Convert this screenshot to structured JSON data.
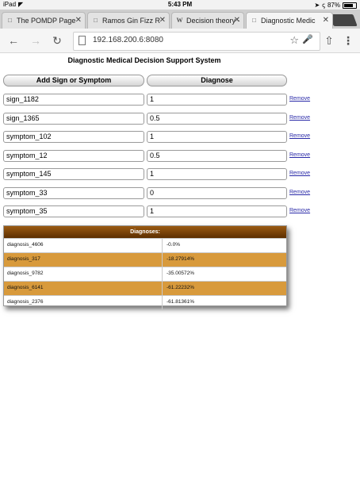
{
  "status_bar": {
    "device": "iPad",
    "time": "5:43 PM",
    "battery": "87%"
  },
  "tabs": [
    {
      "title": "The POMDP Page",
      "icon": "page-icon"
    },
    {
      "title": "Ramos Gin Fizz R",
      "icon": "page-icon"
    },
    {
      "title": "Decision theory -",
      "icon": "W"
    },
    {
      "title": "Diagnostic Medic",
      "icon": "page-icon",
      "active": true
    }
  ],
  "toolbar": {
    "url": "192.168.200.6:8080"
  },
  "page": {
    "title": "Diagnostic Medical Decision Support System",
    "add_button": "Add Sign or Symptom",
    "diagnose_button": "Diagnose",
    "remove_label": "Remove",
    "rows": [
      {
        "name": "sign_1182",
        "value": "1"
      },
      {
        "name": "sign_1365",
        "value": "0.5"
      },
      {
        "name": "symptom_102",
        "value": "1"
      },
      {
        "name": "symptom_12",
        "value": "0.5"
      },
      {
        "name": "symptom_145",
        "value": "1"
      },
      {
        "name": "symptom_33",
        "value": "0"
      },
      {
        "name": "symptom_35",
        "value": "1"
      }
    ],
    "diagnoses": {
      "header": "Diagnoses:",
      "rows": [
        {
          "name": "diagnosis_4606",
          "value": "-0.0%"
        },
        {
          "name": "diagnosis_317",
          "value": "-18.27914%"
        },
        {
          "name": "diagnosis_9782",
          "value": "-35.00572%"
        },
        {
          "name": "diagnosis_6141",
          "value": "-61.22232%"
        },
        {
          "name": "diagnosis_2376",
          "value": "-61.81361%"
        }
      ]
    }
  },
  "colors": {
    "highlight_row": "#d89a3c",
    "table_header": "#7a4208",
    "link": "#2a2aa8"
  }
}
